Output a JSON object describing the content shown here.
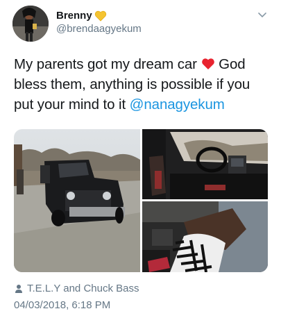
{
  "user": {
    "display_name": "Brenny",
    "handle": "@brendaagyekum",
    "name_emoji": "yellow-heart-icon",
    "avatar": "avatar-photo"
  },
  "tweet": {
    "text_part1": "My parents got my dream car ",
    "emoji": "red-heart-icon",
    "text_part2": " God bless them, anything is possible if you put your mind to it ",
    "mention": "@nanagyekum"
  },
  "media": {
    "images": [
      "black-suv-exterior-photo",
      "car-interior-dashboard-photo",
      "car-interior-seat-photo"
    ]
  },
  "tagged": {
    "icon": "person-icon",
    "text": "T.E.L.Y and Chuck Bass"
  },
  "timestamp": "04/03/2018, 6:18 PM",
  "menu_icon": "chevron-down-icon"
}
